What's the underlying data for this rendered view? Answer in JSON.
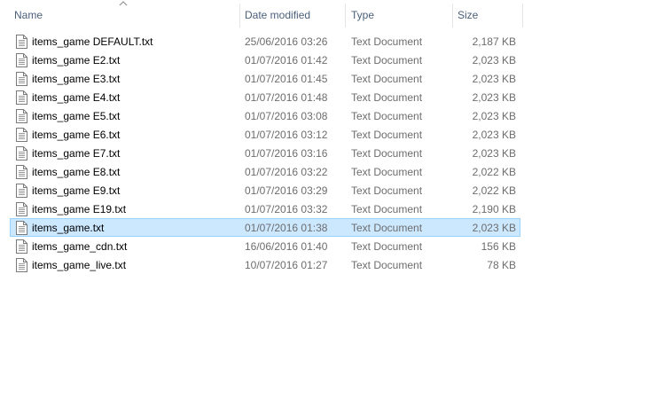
{
  "columns": {
    "name": "Name",
    "date_modified": "Date modified",
    "type": "Type",
    "size": "Size"
  },
  "sort": {
    "column": "name",
    "direction": "ascending",
    "icon": "chevron-up-icon"
  },
  "file_icon": "text-document-icon",
  "colors": {
    "selected_bg": "#cce8ff",
    "selected_border": "#99d1ff",
    "header_text": "#4c607a"
  },
  "files": [
    {
      "name": "items_game DEFAULT.txt",
      "date": "25/06/2016 03:26",
      "type": "Text Document",
      "size": "2,187 KB",
      "selected": false
    },
    {
      "name": "items_game E2.txt",
      "date": "01/07/2016 01:42",
      "type": "Text Document",
      "size": "2,023 KB",
      "selected": false
    },
    {
      "name": "items_game E3.txt",
      "date": "01/07/2016 01:45",
      "type": "Text Document",
      "size": "2,023 KB",
      "selected": false
    },
    {
      "name": "items_game E4.txt",
      "date": "01/07/2016 01:48",
      "type": "Text Document",
      "size": "2,023 KB",
      "selected": false
    },
    {
      "name": "items_game E5.txt",
      "date": "01/07/2016 03:08",
      "type": "Text Document",
      "size": "2,023 KB",
      "selected": false
    },
    {
      "name": "items_game E6.txt",
      "date": "01/07/2016 03:12",
      "type": "Text Document",
      "size": "2,023 KB",
      "selected": false
    },
    {
      "name": "items_game E7.txt",
      "date": "01/07/2016 03:16",
      "type": "Text Document",
      "size": "2,023 KB",
      "selected": false
    },
    {
      "name": "items_game E8.txt",
      "date": "01/07/2016 03:22",
      "type": "Text Document",
      "size": "2,022 KB",
      "selected": false
    },
    {
      "name": "items_game E9.txt",
      "date": "01/07/2016 03:29",
      "type": "Text Document",
      "size": "2,022 KB",
      "selected": false
    },
    {
      "name": "items_game E19.txt",
      "date": "01/07/2016 03:32",
      "type": "Text Document",
      "size": "2,190 KB",
      "selected": false
    },
    {
      "name": "items_game.txt",
      "date": "01/07/2016 01:38",
      "type": "Text Document",
      "size": "2,023 KB",
      "selected": true
    },
    {
      "name": "items_game_cdn.txt",
      "date": "16/06/2016 01:40",
      "type": "Text Document",
      "size": "156 KB",
      "selected": false
    },
    {
      "name": "items_game_live.txt",
      "date": "10/07/2016 01:27",
      "type": "Text Document",
      "size": "78 KB",
      "selected": false
    }
  ]
}
